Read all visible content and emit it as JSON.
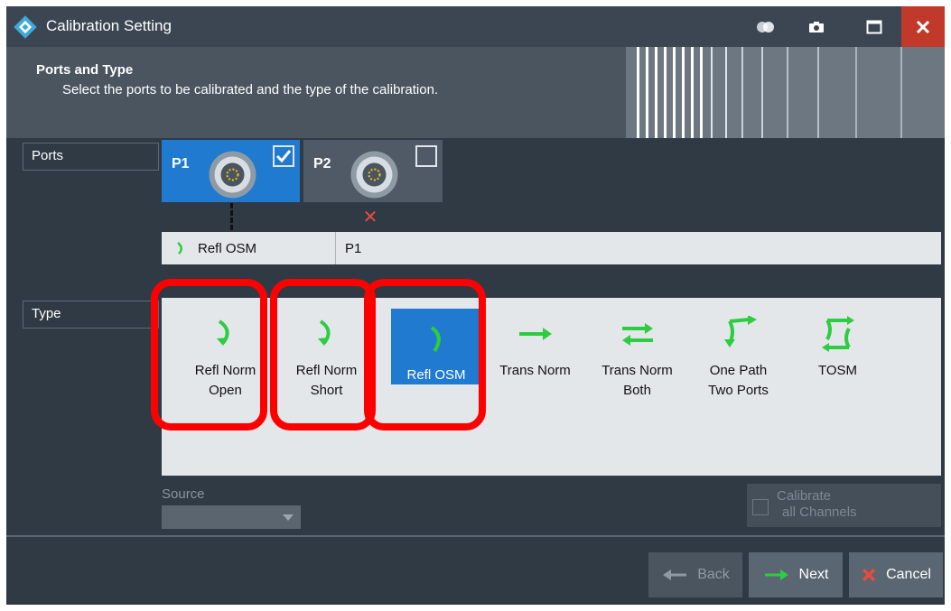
{
  "window": {
    "title": "Calibration Setting"
  },
  "header": {
    "title": "Ports and Type",
    "subtitle": "Select the ports to be calibrated and the type of the calibration."
  },
  "ports": {
    "label": "Ports",
    "items": [
      {
        "name": "P1",
        "checked": true
      },
      {
        "name": "P2",
        "checked": false
      }
    ]
  },
  "summary": {
    "type": "Refl OSM",
    "ports": "P1"
  },
  "type": {
    "label": "Type",
    "selected": "Refl OSM",
    "items": [
      {
        "line1": "Refl Norm",
        "line2": "Open",
        "icon": "refl-arc-icon"
      },
      {
        "line1": "Refl Norm",
        "line2": "Short",
        "icon": "refl-arc-icon"
      },
      {
        "line1": "Refl OSM",
        "line2": "",
        "icon": "refl-arc-icon"
      },
      {
        "line1": "Trans Norm",
        "line2": "",
        "icon": "arrow-right-icon"
      },
      {
        "line1": "Trans Norm",
        "line2": "Both",
        "icon": "arrows-both-icon"
      },
      {
        "line1": "One Path",
        "line2": "Two Ports",
        "icon": "one-path-icon"
      },
      {
        "line1": "TOSM",
        "line2": "",
        "icon": "tosm-icon"
      }
    ]
  },
  "source": {
    "label": "Source",
    "value": ""
  },
  "calibrate_all": {
    "line1": "Calibrate",
    "line2": "all Channels",
    "checked": false
  },
  "footer": {
    "back": "Back",
    "next": "Next",
    "cancel": "Cancel"
  },
  "colors": {
    "accent": "#1f7ad0",
    "icon_green": "#2ecc40",
    "highlight": "#ff0000",
    "close_red": "#c0392b"
  }
}
